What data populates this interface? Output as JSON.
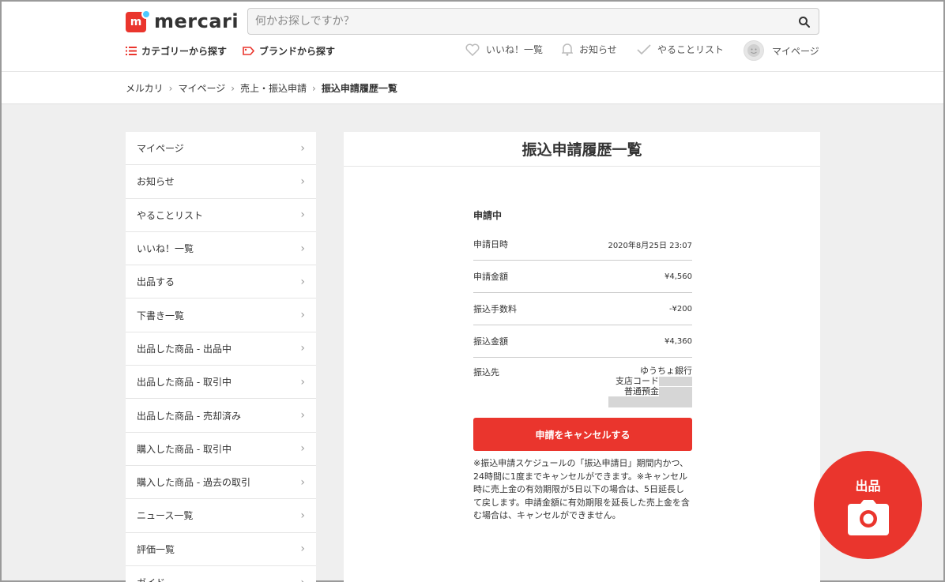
{
  "header": {
    "logo_text": "mercari",
    "logo_mark": "m",
    "search_placeholder": "何かお探しですか？",
    "category_link": "カテゴリーから探す",
    "brand_link": "ブランドから探す",
    "likes_link": "いいね！一覧",
    "news_link": "お知らせ",
    "todo_link": "やることリスト",
    "mypage_link": "マイページ"
  },
  "breadcrumb": {
    "items": [
      "メルカリ",
      "マイページ",
      "売上・振込申請"
    ],
    "current": "振込申請履歴一覧",
    "separator": "›"
  },
  "sidebar": {
    "items": [
      "マイページ",
      "お知らせ",
      "やることリスト",
      "いいね！一覧",
      "出品する",
      "下書き一覧",
      "出品した商品 - 出品中",
      "出品した商品 - 取引中",
      "出品した商品 - 売却済み",
      "購入した商品 - 取引中",
      "購入した商品 - 過去の取引",
      "ニュース一覧",
      "評価一覧",
      "ガイド"
    ],
    "chevron": "›"
  },
  "main": {
    "title": "振込申請履歴一覧",
    "status": "申請中",
    "rows": [
      {
        "label": "申請日時",
        "value": "2020年8月25日 23:07"
      },
      {
        "label": "申請金額",
        "value": "¥4,560"
      },
      {
        "label": "振込手数料",
        "value": "-¥200"
      },
      {
        "label": "振込金額",
        "value": "¥4,360"
      }
    ],
    "bank": {
      "label": "振込先",
      "bank_name": "ゆうちょ銀行",
      "branch": "支店コード",
      "account_type": "普通預金"
    },
    "cancel_button": "申請をキャンセルする",
    "note": "※振込申請スケジュールの「振込申請日」期間内かつ、24時間に1度までキャンセルができます。※キャンセル時に売上金の有効期限が5日以下の場合は、5日延長して戻します。申請金額に有効期限を延長した売上金を含む場合は、キャンセルができません。"
  },
  "fab": {
    "label": "出品",
    "icon": "camera-icon"
  },
  "colors": {
    "brand_red": "#ea352d",
    "logo_blue": "#4dc9ff",
    "background": "#efefef"
  }
}
